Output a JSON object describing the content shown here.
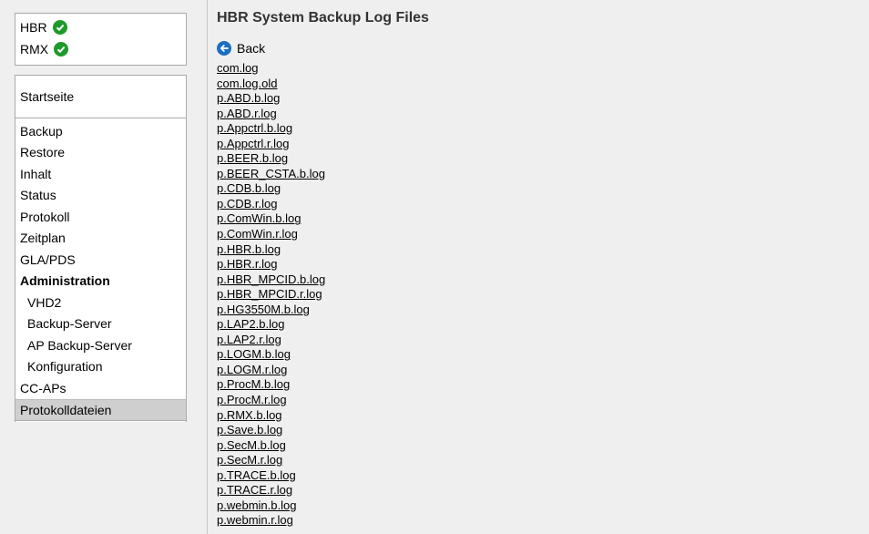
{
  "status": [
    {
      "label": "HBR",
      "icon": "check-icon",
      "color": "#1e9a2a"
    },
    {
      "label": "RMX",
      "icon": "check-icon",
      "color": "#1e9a2a"
    }
  ],
  "nav": {
    "home": "Startseite",
    "items": [
      {
        "label": "Backup"
      },
      {
        "label": "Restore"
      },
      {
        "label": "Inhalt"
      },
      {
        "label": "Status"
      },
      {
        "label": "Protokoll"
      },
      {
        "label": "Zeitplan"
      },
      {
        "label": "GLA/PDS"
      },
      {
        "label": "Administration"
      },
      {
        "label": "VHD2"
      },
      {
        "label": "Backup-Server"
      },
      {
        "label": "AP Backup-Server"
      },
      {
        "label": "Konfiguration"
      },
      {
        "label": "CC-APs"
      },
      {
        "label": "Protokolldateien"
      }
    ]
  },
  "main": {
    "title": "HBR System Backup Log Files",
    "back_label": "Back",
    "files": [
      "com.log",
      "com.log.old",
      "p.ABD.b.log",
      "p.ABD.r.log",
      "p.Appctrl.b.log",
      "p.Appctrl.r.log",
      "p.BEER.b.log",
      "p.BEER_CSTA.b.log",
      "p.CDB.b.log",
      "p.CDB.r.log",
      "p.ComWin.b.log",
      "p.ComWin.r.log",
      "p.HBR.b.log",
      "p.HBR.r.log",
      "p.HBR_MPCID.b.log",
      "p.HBR_MPCID.r.log",
      "p.HG3550M.b.log",
      "p.LAP2.b.log",
      "p.LAP2.r.log",
      "p.LOGM.b.log",
      "p.LOGM.r.log",
      "p.ProcM.b.log",
      "p.ProcM.r.log",
      "p.RMX.b.log",
      "p.Save.b.log",
      "p.SecM.b.log",
      "p.SecM.r.log",
      "p.TRACE.b.log",
      "p.TRACE.r.log",
      "p.webmin.b.log",
      "p.webmin.r.log"
    ]
  },
  "colors": {
    "accent_check": "#1e9a2a",
    "back_icon": "#1a6fc4",
    "active_bg": "#cfcfcf"
  }
}
